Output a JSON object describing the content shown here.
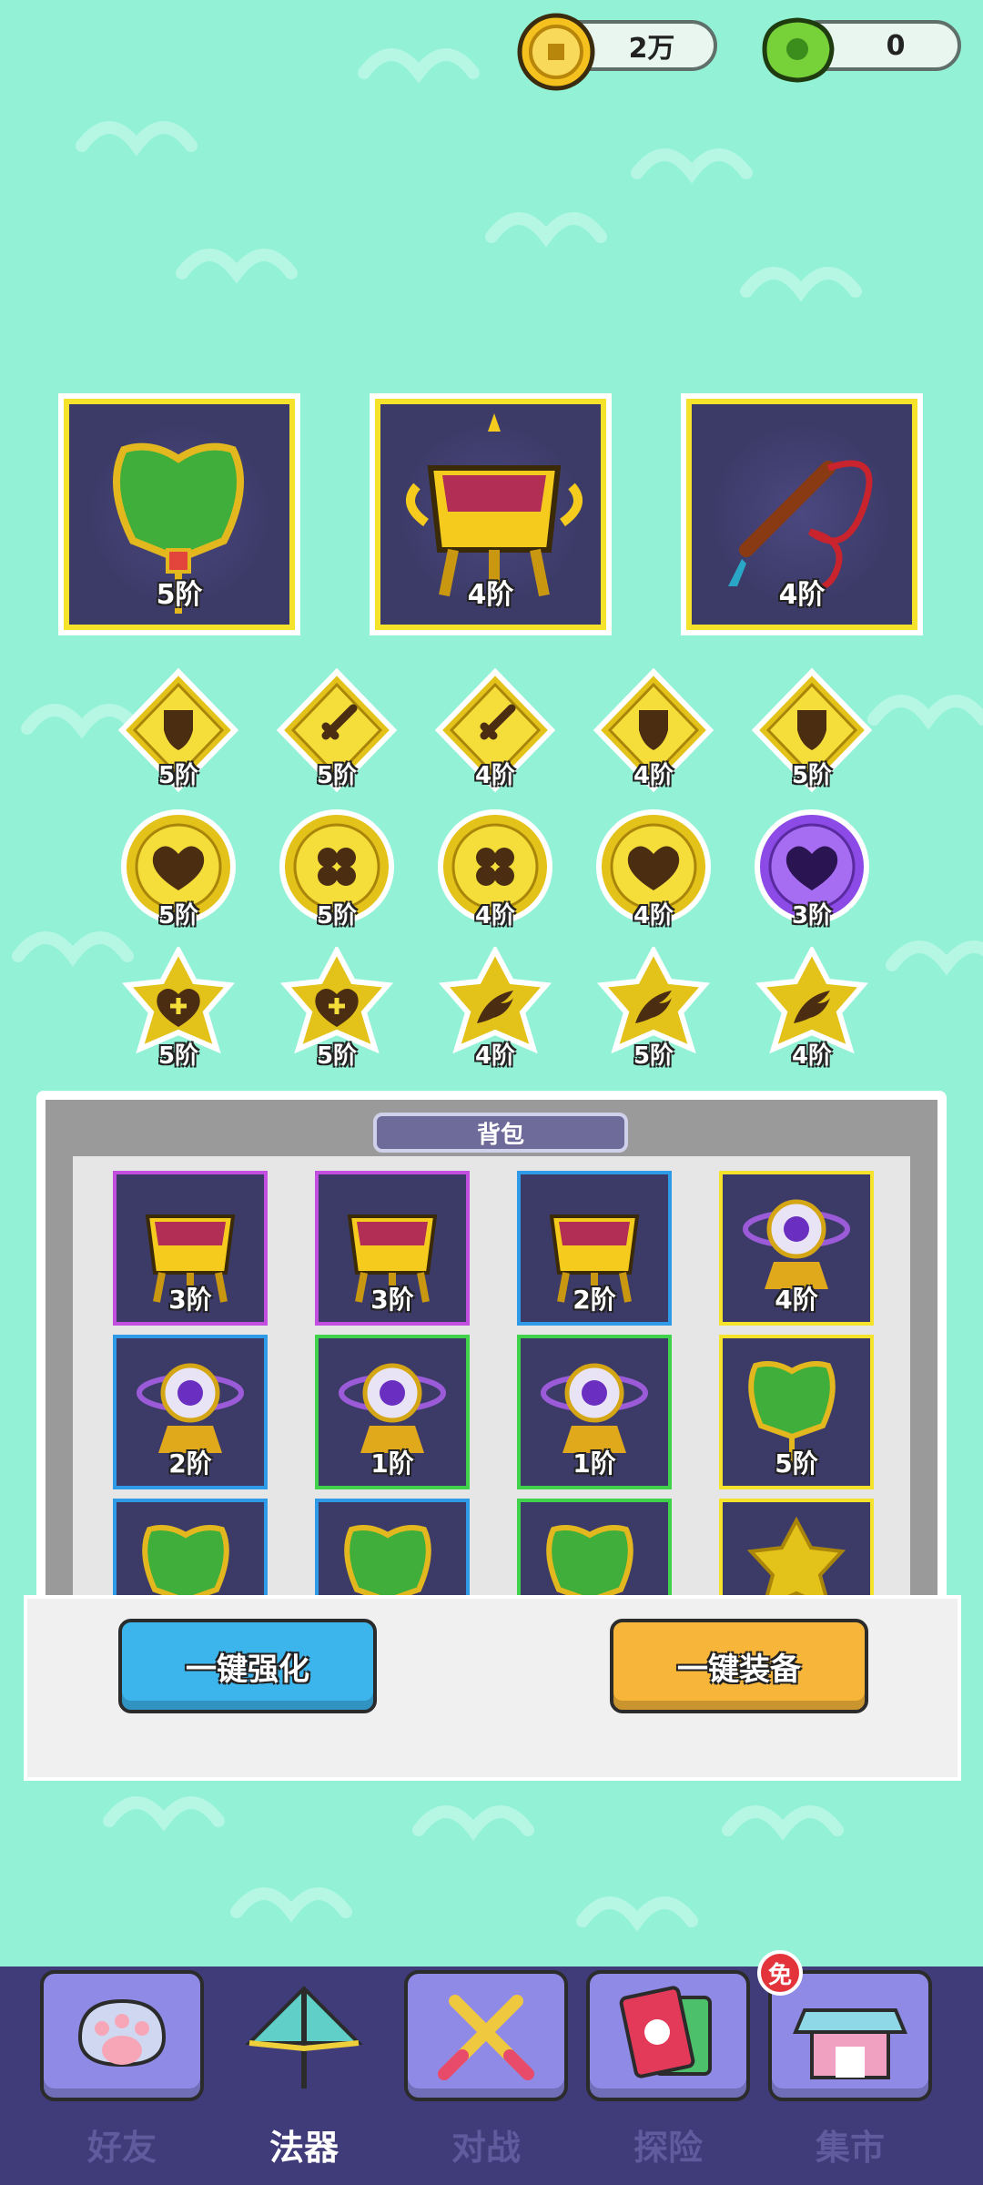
{
  "currency": {
    "coins": "2万",
    "gems": "0"
  },
  "main_slots": [
    {
      "item": "jade-fan",
      "tier": "5阶"
    },
    {
      "item": "golden-cauldron",
      "tier": "4阶"
    },
    {
      "item": "red-whip",
      "tier": "4阶"
    }
  ],
  "gem_rows": [
    [
      {
        "shape": "diamond",
        "emblem": "shield",
        "tier": "5阶"
      },
      {
        "shape": "diamond",
        "emblem": "sword",
        "tier": "5阶"
      },
      {
        "shape": "diamond",
        "emblem": "sword",
        "tier": "4阶"
      },
      {
        "shape": "diamond",
        "emblem": "shield",
        "tier": "4阶"
      },
      {
        "shape": "diamond",
        "emblem": "shield",
        "tier": "5阶"
      }
    ],
    [
      {
        "shape": "circle",
        "emblem": "heart",
        "tier": "5阶"
      },
      {
        "shape": "circle",
        "emblem": "clover",
        "tier": "5阶"
      },
      {
        "shape": "circle",
        "emblem": "clover",
        "tier": "4阶"
      },
      {
        "shape": "circle",
        "emblem": "heart",
        "tier": "4阶"
      },
      {
        "shape": "circle",
        "emblem": "heart",
        "tier": "3阶",
        "color": "purple"
      }
    ],
    [
      {
        "shape": "star",
        "emblem": "heart-plus",
        "tier": "5阶"
      },
      {
        "shape": "star",
        "emblem": "heart-plus",
        "tier": "5阶"
      },
      {
        "shape": "star",
        "emblem": "wing",
        "tier": "4阶"
      },
      {
        "shape": "star",
        "emblem": "wing",
        "tier": "5阶"
      },
      {
        "shape": "star",
        "emblem": "wing",
        "tier": "4阶"
      }
    ]
  ],
  "backpack": {
    "title": "背包",
    "items": [
      {
        "item": "golden-cauldron",
        "tier": "3阶",
        "rarity": "#c24fe0"
      },
      {
        "item": "golden-cauldron",
        "tier": "3阶",
        "rarity": "#c24fe0"
      },
      {
        "item": "golden-cauldron",
        "tier": "2阶",
        "rarity": "#2f9be8"
      },
      {
        "item": "crystal-eye",
        "tier": "4阶",
        "rarity": "#f5e22a"
      },
      {
        "item": "crystal-eye",
        "tier": "2阶",
        "rarity": "#2f9be8"
      },
      {
        "item": "crystal-eye",
        "tier": "1阶",
        "rarity": "#3fd24a"
      },
      {
        "item": "crystal-eye",
        "tier": "1阶",
        "rarity": "#3fd24a"
      },
      {
        "item": "jade-fan",
        "tier": "5阶",
        "rarity": "#f5e22a"
      },
      {
        "item": "jade-fan",
        "tier": "",
        "rarity": "#2f9be8"
      },
      {
        "item": "jade-fan",
        "tier": "",
        "rarity": "#2f9be8"
      },
      {
        "item": "jade-fan",
        "tier": "",
        "rarity": "#3fd24a"
      },
      {
        "item": "star-gem",
        "tier": "",
        "rarity": "#f5e22a"
      }
    ]
  },
  "actions": {
    "enhance_label": "一键强化",
    "equip_label": "一键装备"
  },
  "nav": [
    {
      "label": "好友",
      "icon": "paw-icon"
    },
    {
      "label": "法器",
      "icon": "umbrella-icon",
      "active": true
    },
    {
      "label": "对战",
      "icon": "crossed-swords-icon"
    },
    {
      "label": "探险",
      "icon": "cards-icon"
    },
    {
      "label": "集市",
      "icon": "market-stall-icon",
      "badge": "免"
    }
  ],
  "colors": {
    "background": "#93f2d6",
    "slot_bg": "#3c3b68",
    "gold": "#f5d22a",
    "nav_bg": "#403c7a"
  }
}
